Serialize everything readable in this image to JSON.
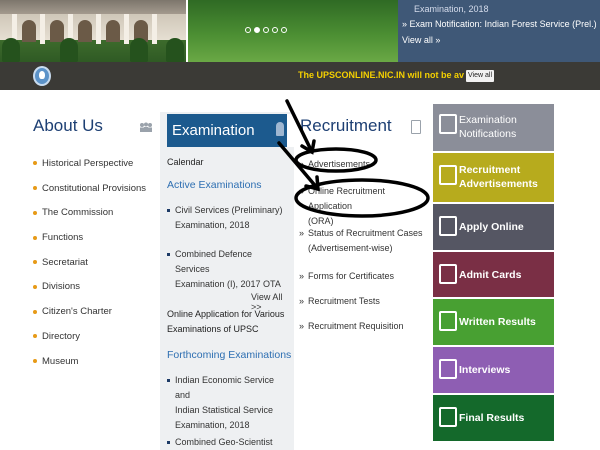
{
  "banner": {
    "slider_dot_count": 5,
    "slider_active_dot": 2,
    "news": {
      "top_line": "Examination, 2018",
      "item": "Exam Notification: Indian Forest Service (Prel.)",
      "view_all": "View all »"
    }
  },
  "marquee": {
    "text": "The UPSCONLINE.NIC.IN will not be available fro",
    "button": "View all",
    "icon": "bulb-icon"
  },
  "about": {
    "title": "About Us",
    "icon": "people-icon",
    "items": [
      "Historical Perspective",
      "Constitutional Provisions",
      "The Commission",
      "Functions",
      "Secretariat",
      "Divisions",
      "Citizen's Charter",
      "Directory",
      "Museum"
    ]
  },
  "examination": {
    "title": "Examination",
    "calendar": "Calendar",
    "active_heading": "Active Examinations",
    "active_items": [
      [
        "Civil Services (Preliminary)",
        "Examination, 2018"
      ],
      [
        "Combined Defence Services",
        "Examination (I), 2017 OTA"
      ]
    ],
    "view_all": "View All >>",
    "online_application": [
      "Online Application for Various",
      "Examinations of UPSC"
    ],
    "forthcoming_heading": "Forthcoming Examinations",
    "forthcoming_items": [
      [
        "Indian Economic Service and",
        "Indian Statistical Service",
        "Examination, 2018"
      ],
      [
        "Combined Geo-Scientist and"
      ]
    ]
  },
  "recruitment": {
    "title": "Recruitment",
    "icon": "clipboard-icon",
    "items": [
      [
        "Advertisements"
      ],
      [
        "Online Recruitment Application",
        "(ORA)"
      ],
      [
        "Status of Recruitment Cases",
        "(Advertisement-wise)"
      ],
      [
        "Forms for Certificates"
      ],
      [
        "Recruitment Tests"
      ],
      [
        "Recruitment Requisition"
      ]
    ]
  },
  "tiles": [
    {
      "label": [
        "Examination",
        "Notifications"
      ],
      "color": "#8b8e99",
      "icon": "notification-icon"
    },
    {
      "label": [
        "Recruitment",
        "Advertisements"
      ],
      "color": "#b7ab1d",
      "icon": "megaphone-icon"
    },
    {
      "label": [
        "Apply Online"
      ],
      "color": "#555663",
      "icon": "form-edit-icon"
    },
    {
      "label": [
        "Admit Cards"
      ],
      "color": "#7a2f45",
      "icon": "id-card-icon"
    },
    {
      "label": [
        "Written Results"
      ],
      "color": "#48a032",
      "icon": "bar-chart-icon"
    },
    {
      "label": [
        "Interviews"
      ],
      "color": "#8e5eb3",
      "icon": "people-group-icon"
    },
    {
      "label": [
        "Final Results"
      ],
      "color": "#14692b",
      "icon": "document-list-icon"
    }
  ],
  "annotations": {
    "color": "#000000",
    "marks": [
      "arrow-to-advertisements",
      "circle-advertisements",
      "arrow-to-ora",
      "circle-ora"
    ]
  }
}
